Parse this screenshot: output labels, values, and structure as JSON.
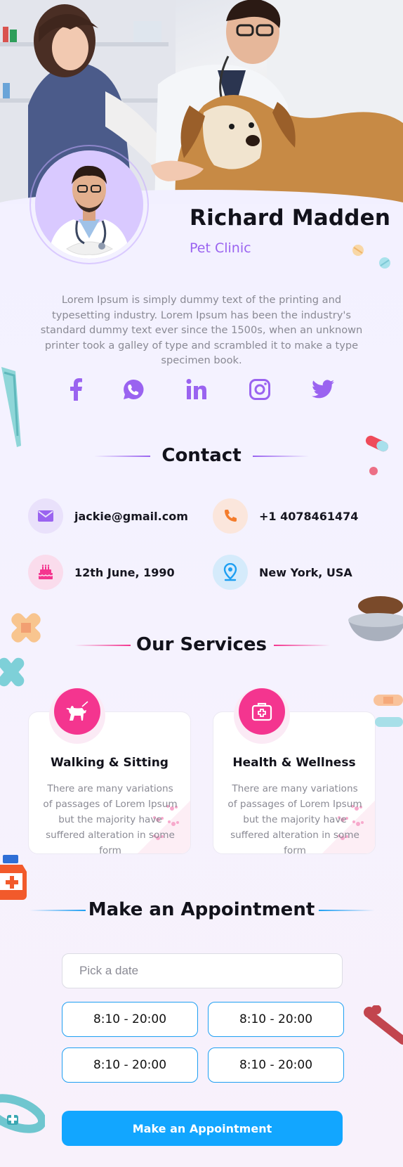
{
  "profile": {
    "name": "Richard Madden",
    "role": "Pet Clinic",
    "bio": "Lorem Ipsum is simply dummy text of the printing and typesetting industry. Lorem Ipsum has been the industry's standard dummy text ever since the 1500s, when an unknown printer took a galley of type and scrambled it to make a type specimen book."
  },
  "socials": [
    {
      "icon": "facebook-icon"
    },
    {
      "icon": "whatsapp-icon"
    },
    {
      "icon": "linkedin-icon"
    },
    {
      "icon": "instagram-icon"
    },
    {
      "icon": "twitter-icon"
    }
  ],
  "contact": {
    "title": "Contact",
    "email": "jackie@gmail.com",
    "phone": "+1 4078461474",
    "birthday": "12th June, 1990",
    "location": "New York, USA"
  },
  "services": {
    "title": "Our Services",
    "items": [
      {
        "title": "Walking & Sitting",
        "description": "There are many variations of passages of Lorem Ipsum but the majority have suffered alteration in some form"
      },
      {
        "title": "Health & Wellness",
        "description": "There are many variations of passages of Lorem Ipsum but the majority have suffered alteration in some form"
      }
    ]
  },
  "appointment": {
    "title": "Make an Appointment",
    "date_placeholder": "Pick a date",
    "slots": [
      "8:10 - 20:00",
      "8:10 - 20:00",
      "8:10 - 20:00",
      "8:10 - 20:00"
    ],
    "button_label": "Make an Appointment"
  },
  "colors": {
    "accent_purple": "#9a63f0",
    "service_pink": "#f4358f",
    "cta_blue": "#12a6ff",
    "slot_border": "#1e9ff2"
  }
}
